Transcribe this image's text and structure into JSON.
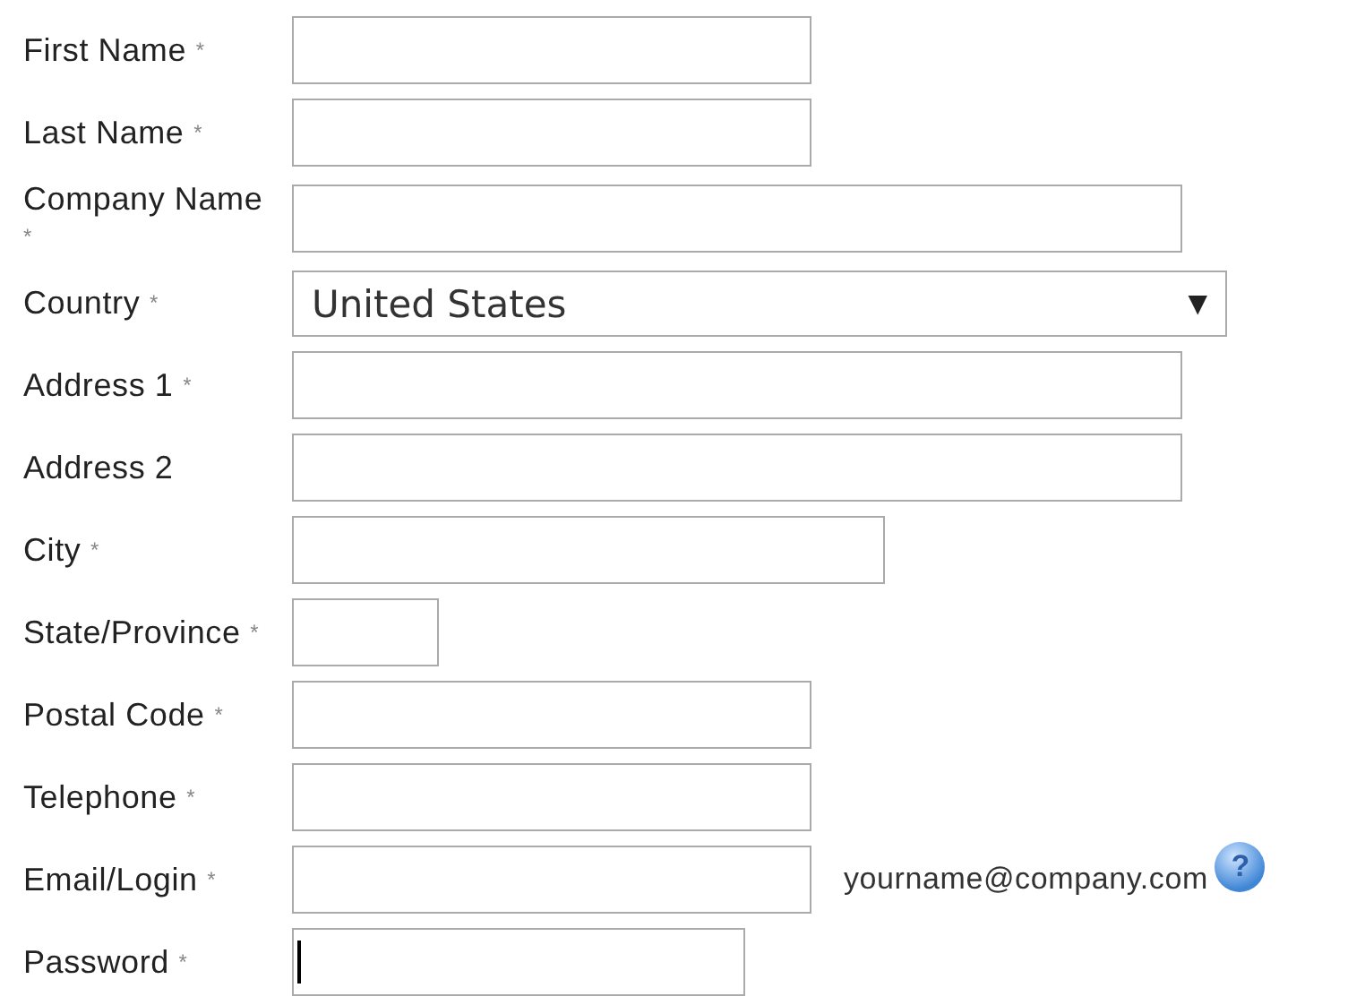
{
  "form": {
    "fields": [
      {
        "kind": "text",
        "label": "First Name",
        "required_mark": "*"
      },
      {
        "kind": "text",
        "label": "Last Name",
        "required_mark": "*"
      },
      {
        "kind": "text",
        "label": "Company Name",
        "required_mark": "*"
      },
      {
        "kind": "select",
        "label": "Country",
        "required_mark": "*",
        "value": "United States",
        "arrow": "▼"
      },
      {
        "kind": "text",
        "label": "Address 1",
        "required_mark": "*"
      },
      {
        "kind": "text",
        "label": "Address 2"
      },
      {
        "kind": "text",
        "label": "City",
        "required_mark": "*"
      },
      {
        "kind": "text",
        "label": "State/Province",
        "required_mark": "*"
      },
      {
        "kind": "text",
        "label": "Postal Code",
        "required_mark": "*"
      },
      {
        "kind": "text",
        "label": "Telephone",
        "required_mark": "*"
      },
      {
        "kind": "text",
        "label": "Email/Login",
        "required_mark": "*",
        "hint": "yourname@company.com",
        "help": "?"
      },
      {
        "kind": "password",
        "label": "Password",
        "required_mark": "*",
        "focused": true
      }
    ]
  }
}
